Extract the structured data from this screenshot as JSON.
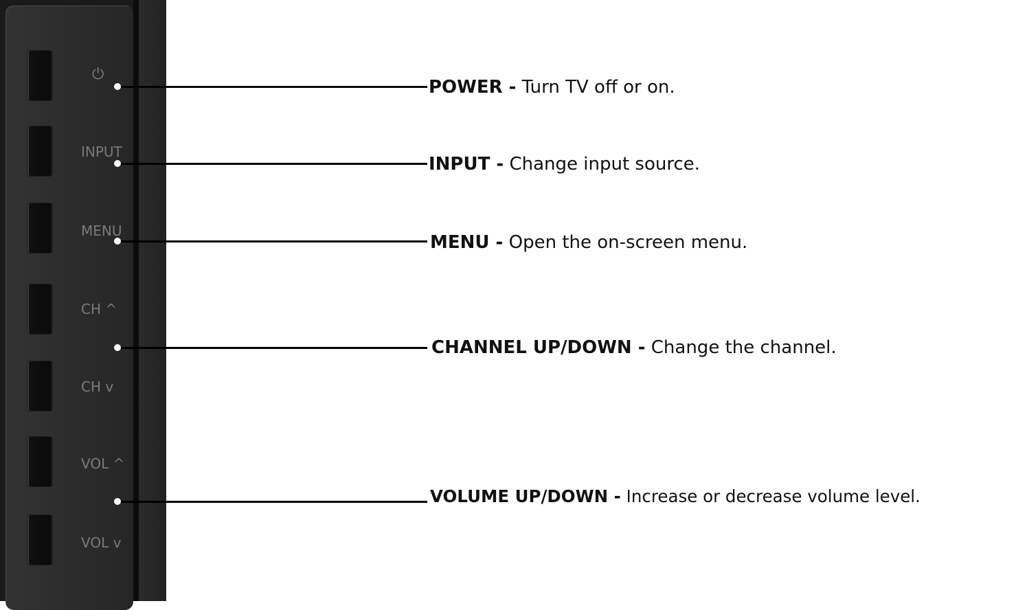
{
  "panel": {
    "buttons": [
      {
        "label": "⏻",
        "icon": "power-icon"
      },
      {
        "label": "INPUT"
      },
      {
        "label": "MENU"
      },
      {
        "label": "CH ^"
      },
      {
        "label": "CH v"
      },
      {
        "label": "VOL ^"
      },
      {
        "label": "VOL v"
      }
    ]
  },
  "callouts": [
    {
      "name": "POWER -",
      "text": " Turn TV off or on."
    },
    {
      "name": "INPUT -",
      "text": " Change input source."
    },
    {
      "name": "MENU -",
      "text": " Open the on-screen menu."
    },
    {
      "name": "CHANNEL UP/DOWN -",
      "text": " Change the channel."
    },
    {
      "name": "VOLUME UP/DOWN -",
      "text": " Increase or decrease volume level."
    }
  ]
}
